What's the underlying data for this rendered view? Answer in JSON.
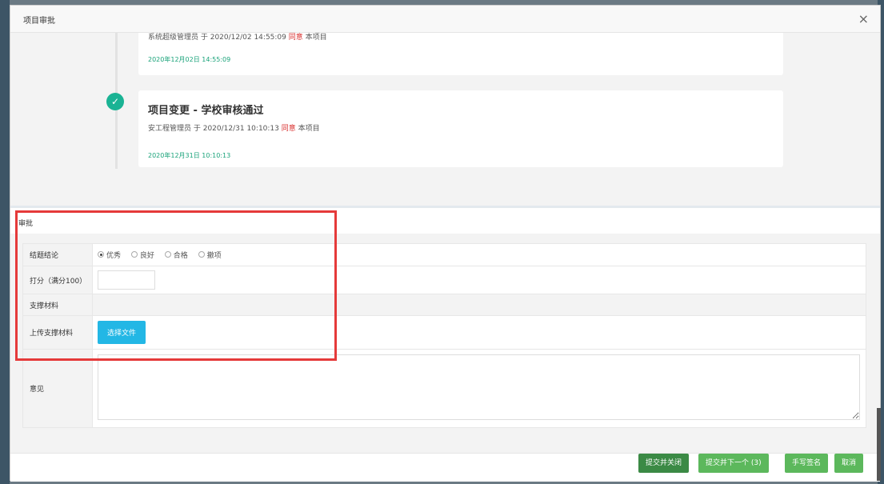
{
  "modal": {
    "title": "项目审批",
    "close_symbol": "×"
  },
  "timeline": {
    "items": [
      {
        "title": "",
        "desc_prefix": "系统超级管理员 于 2020/12/02 14:55:09 ",
        "desc_agree": "同意",
        "desc_suffix": " 本项目",
        "time": "2020年12月02日 14:55:09"
      },
      {
        "title": "项目变更 - 学校审核通过",
        "desc_prefix": "安工程管理员 于 2020/12/31 10:10:13 ",
        "desc_agree": "同意",
        "desc_suffix": " 本项目",
        "time": "2020年12月31日 10:10:13"
      }
    ],
    "check_symbol": "✓"
  },
  "approval": {
    "section_title": "审批",
    "conclusion_label": "结题结论",
    "conclusion_options": [
      "优秀",
      "良好",
      "合格",
      "撤项"
    ],
    "conclusion_selected": "优秀",
    "score_label": "打分（满分100）",
    "score_value": "",
    "materials_label": "支撑材料",
    "upload_label": "上传支撑材料",
    "upload_button": "选择文件",
    "opinion_label": "意见",
    "opinion_value": ""
  },
  "footer": {
    "submit_close": "提交并关闭",
    "submit_next": "提交并下一个 (3)",
    "handwrite_sign": "手写签名",
    "cancel": "取消"
  },
  "colors": {
    "agree_red": "#d9302f",
    "time_green": "#1aa37a",
    "check_green": "#1ab394",
    "upload_blue": "#23b7e5",
    "btn_dark_green": "#3b8a45",
    "btn_green": "#5cb85c",
    "highlight_red": "#e53a3a"
  }
}
